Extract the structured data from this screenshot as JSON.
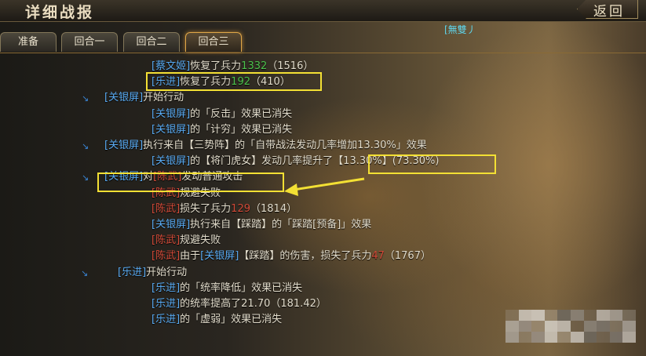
{
  "window": {
    "title": "详细战报",
    "back_label": "返回",
    "header_tag": "[無雙丿"
  },
  "tabs": [
    {
      "label": "准备"
    },
    {
      "label": "回合一"
    },
    {
      "label": "回合二"
    },
    {
      "label": "回合三",
      "active": true
    }
  ],
  "log": [
    {
      "kind": "sub",
      "parts": [
        {
          "t": "[蔡文姬]",
          "c": "blue"
        },
        {
          "t": "恢复了兵力"
        },
        {
          "t": "1332",
          "c": "green"
        },
        {
          "t": "（1516）"
        }
      ]
    },
    {
      "kind": "sub",
      "parts": [
        {
          "t": "[乐进]",
          "c": "blue"
        },
        {
          "t": "恢复了兵力"
        },
        {
          "t": "192",
          "c": "green"
        },
        {
          "t": "（410）"
        }
      ]
    },
    {
      "kind": "main",
      "parts": [
        {
          "t": "[关银屏]",
          "c": "blue"
        },
        {
          "t": "开始行动"
        }
      ]
    },
    {
      "kind": "sub",
      "parts": [
        {
          "t": "[关银屏]",
          "c": "blue"
        },
        {
          "t": "的「反击」效果已消失"
        }
      ]
    },
    {
      "kind": "sub",
      "parts": [
        {
          "t": "[关银屏]",
          "c": "blue"
        },
        {
          "t": "的「计穷」效果已消失"
        }
      ]
    },
    {
      "kind": "main",
      "parts": [
        {
          "t": "[关银屏]",
          "c": "blue"
        },
        {
          "t": "执行来自【三势阵】的「自带战法发动几率增加13.30%」效果"
        }
      ]
    },
    {
      "kind": "sub",
      "parts": [
        {
          "t": "[关银屏]",
          "c": "blue"
        },
        {
          "t": "的【将门虎女】发动几率提升了"
        },
        {
          "t": "【13.30%】(73.30%)"
        }
      ]
    },
    {
      "kind": "main",
      "parts": [
        {
          "t": "[关银屏]",
          "c": "blue"
        },
        {
          "t": "对"
        },
        {
          "t": "[陈武]",
          "c": "red"
        },
        {
          "t": "发动普通攻击"
        }
      ]
    },
    {
      "kind": "sub",
      "parts": [
        {
          "t": "[陈武]",
          "c": "red"
        },
        {
          "t": "规避失败"
        }
      ]
    },
    {
      "kind": "sub",
      "parts": [
        {
          "t": "[陈武]",
          "c": "red"
        },
        {
          "t": "损失了兵力"
        },
        {
          "t": "129",
          "c": "red"
        },
        {
          "t": "（1814）"
        }
      ]
    },
    {
      "kind": "sub",
      "parts": [
        {
          "t": "[关银屏]",
          "c": "blue"
        },
        {
          "t": "执行来自【踩踏】的「踩踏[预备]」效果"
        }
      ]
    },
    {
      "kind": "sub",
      "parts": [
        {
          "t": "[陈武]",
          "c": "red"
        },
        {
          "t": "规避失败"
        }
      ]
    },
    {
      "kind": "sub",
      "parts": [
        {
          "t": "[陈武]",
          "c": "red"
        },
        {
          "t": "由于"
        },
        {
          "t": "[关银屏]",
          "c": "blue"
        },
        {
          "t": "【踩踏】的伤害，损失了兵力"
        },
        {
          "t": "47",
          "c": "red"
        },
        {
          "t": "（1767）"
        }
      ]
    },
    {
      "kind": "main2",
      "parts": [
        {
          "t": "[乐进]",
          "c": "blue"
        },
        {
          "t": "开始行动"
        }
      ]
    },
    {
      "kind": "sub",
      "parts": [
        {
          "t": "[乐进]",
          "c": "blue"
        },
        {
          "t": "的「统率降低」效果已消失"
        }
      ]
    },
    {
      "kind": "sub",
      "parts": [
        {
          "t": "[乐进]",
          "c": "blue"
        },
        {
          "t": "的统率提高了21.70（181.42）"
        }
      ]
    },
    {
      "kind": "sub",
      "parts": [
        {
          "t": "[乐进]",
          "c": "blue"
        },
        {
          "t": "的「虚弱」效果已消失"
        }
      ]
    }
  ],
  "colors": {
    "blue": "#58a9f0",
    "red": "#d24a38",
    "green": "#4cc24c",
    "highlight": "#f3e034"
  }
}
